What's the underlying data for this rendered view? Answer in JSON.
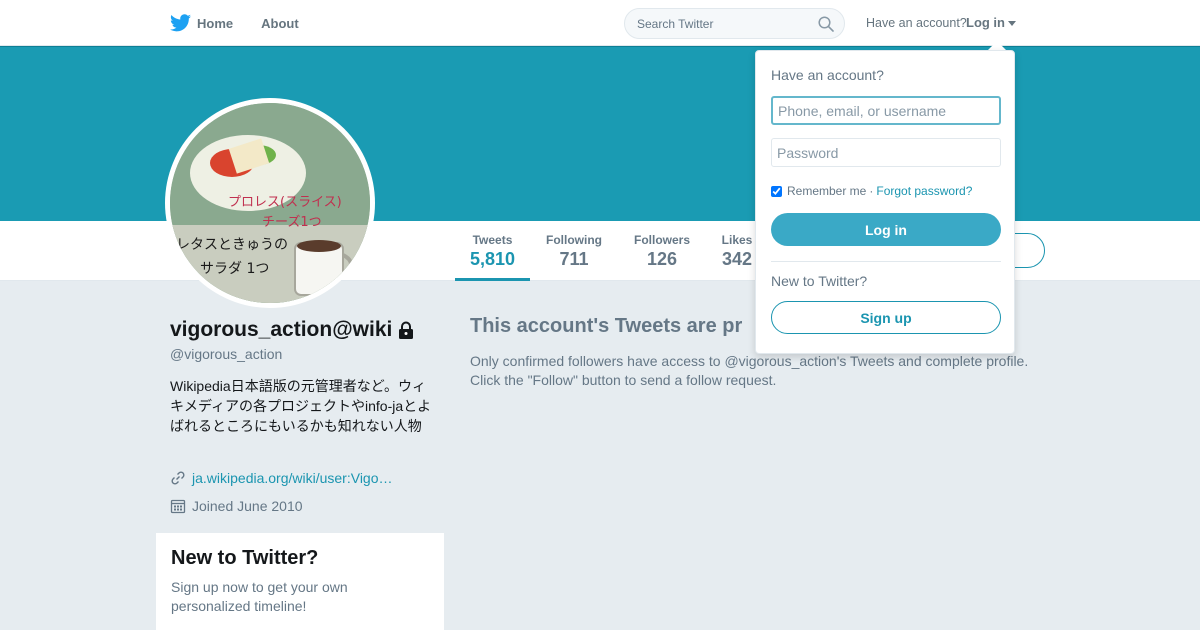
{
  "nav": {
    "home": "Home",
    "about": "About",
    "search_placeholder": "Search Twitter",
    "have_account": "Have an account?",
    "login": "Log in"
  },
  "avatar": {
    "line1": "プロレス(スライス)",
    "line2": "チーズ1つ",
    "line3": "レタスときゅうの",
    "line4": "サラダ 1つ"
  },
  "stats": [
    {
      "label": "Tweets",
      "value": "5,810"
    },
    {
      "label": "Following",
      "value": "711"
    },
    {
      "label": "Followers",
      "value": "126"
    },
    {
      "label": "Likes",
      "value": "342"
    }
  ],
  "profile": {
    "display_name": "vigorous_action@wiki",
    "screen_name": "@vigorous_action",
    "bio": "Wikipedia日本語版の元管理者など。ウィキメディアの各プロジェクトやinfo-jaとよばれるところにもいるかも知れない人物",
    "url": "ja.wikipedia.org/wiki/user:Vigo…",
    "joined": "Joined June 2010"
  },
  "signup_card": {
    "title": "New to Twitter?",
    "text": "Sign up now to get your own personalized timeline!"
  },
  "protected": {
    "title": "This account's Tweets are pr",
    "text": "Only confirmed followers have access to @vigorous_action's Tweets and complete profile. Click the \"Follow\" button to send a follow request."
  },
  "login_dropdown": {
    "title": "Have an account?",
    "username_placeholder": "Phone, email, or username",
    "password_placeholder": "Password",
    "remember": "Remember me",
    "separator": "·",
    "forgot": "Forgot password?",
    "login_button": "Log in",
    "new_to_twitter": "New to Twitter?",
    "signup_button": "Sign up"
  },
  "colors": {
    "banner": "#1a9bb3",
    "accent": "#1b95b0"
  }
}
